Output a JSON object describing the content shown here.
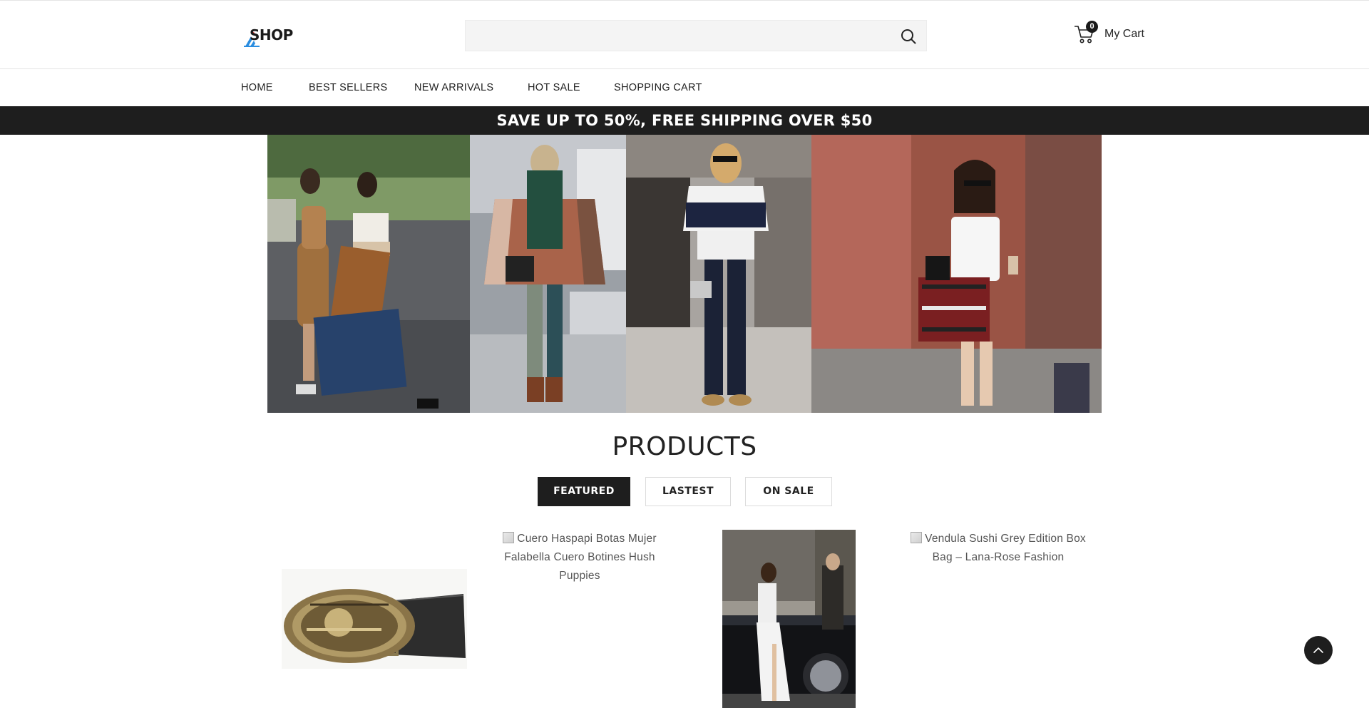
{
  "header": {
    "logo_text": "SHOP",
    "search": {
      "placeholder": "",
      "value": ""
    },
    "cart": {
      "count": "0",
      "label": "My Cart"
    }
  },
  "nav": {
    "items": [
      {
        "label": "HOME"
      },
      {
        "label": "BEST SELLERS"
      },
      {
        "label": "NEW ARRIVALS"
      },
      {
        "label": "HOT SALE"
      },
      {
        "label": "SHOPPING CART"
      }
    ]
  },
  "promo": {
    "text": "SAVE UP TO 50%, FREE SHIPPING OVER $50"
  },
  "products": {
    "title": "PRODUCTS",
    "tabs": [
      {
        "label": "FEATURED",
        "active": true
      },
      {
        "label": "LASTEST",
        "active": false
      },
      {
        "label": "ON SALE",
        "active": false
      }
    ],
    "items": [
      {
        "alt": ""
      },
      {
        "alt": "Cuero Haspapi Botas Mujer Falabella Cuero Botines Hush Puppies"
      },
      {
        "alt": ""
      },
      {
        "alt": "Vendula Sushi Grey Edition Box Bag – Lana-Rose Fashion"
      }
    ]
  },
  "colors": {
    "dark": "#1e1e1e",
    "search_bg": "#f4f4f4",
    "logo_accent": "#2a8de0"
  },
  "icons": {
    "search": "search-icon",
    "cart": "cart-icon",
    "scroll_top": "chevron-up-icon"
  }
}
